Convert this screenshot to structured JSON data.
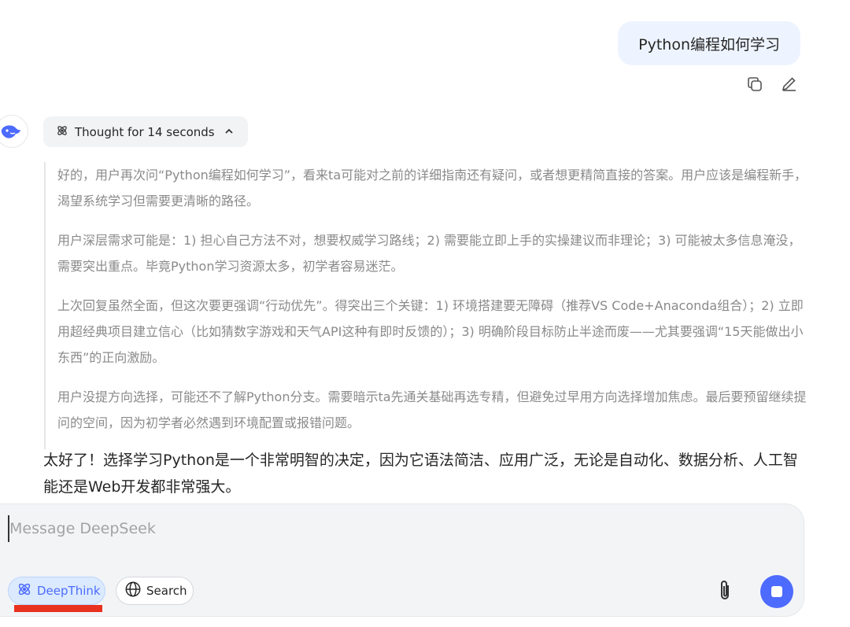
{
  "conversation": {
    "user_message": "Python编程如何学习",
    "thought_label": "Thought for 14 seconds",
    "thinking_paragraphs": [
      "好的，用户再次问“Python编程如何学习”，看来ta可能对之前的详细指南还有疑问，或者想更精简直接的答案。用户应该是编程新手，渴望系统学习但需要更清晰的路径。",
      "用户深层需求可能是：1) 担心自己方法不对，想要权威学习路线；2) 需要能立即上手的实操建议而非理论；3) 可能被太多信息淹没，需要突出重点。毕竟Python学习资源太多，初学者容易迷茫。",
      "上次回复虽然全面，但这次要更强调“行动优先”。得突出三个关键：1) 环境搭建要无障碍（推荐VS Code+Anaconda组合）；2) 立即用超经典项目建立信心（比如猜数字游戏和天气API这种有即时反馈的）；3) 明确阶段目标防止半途而废——尤其要强调“15天能做出小东西”的正向激励。",
      "用户没提方向选择，可能还不了解Python分支。需要暗示ta先通关基础再选专精，但避免过早用方向选择增加焦虑。最后要预留继续提问的空间，因为初学者必然遇到环境配置或报错问题。"
    ],
    "answer_text": "太好了！选择学习Python是一个非常明智的决定，因为它语法简洁、应用广泛，无论是自动化、数据分析、人工智能还是Web开发都非常强大。"
  },
  "composer": {
    "placeholder": "Message DeepSeek",
    "deepthink_label": "DeepThink",
    "search_label": "Search"
  },
  "icons": {
    "copy": "copy-icon",
    "edit": "edit-pencil-icon",
    "avatar": "deepseek-whale-icon",
    "thought": "atom-icon",
    "chevron": "chevron-up-icon",
    "globe": "globe-icon",
    "attach": "paperclip-icon",
    "stop": "stop-icon"
  },
  "colors": {
    "accent": "#4d6bfe",
    "user_bubble": "#eef4ff",
    "highlight_underline": "#e8311e"
  }
}
